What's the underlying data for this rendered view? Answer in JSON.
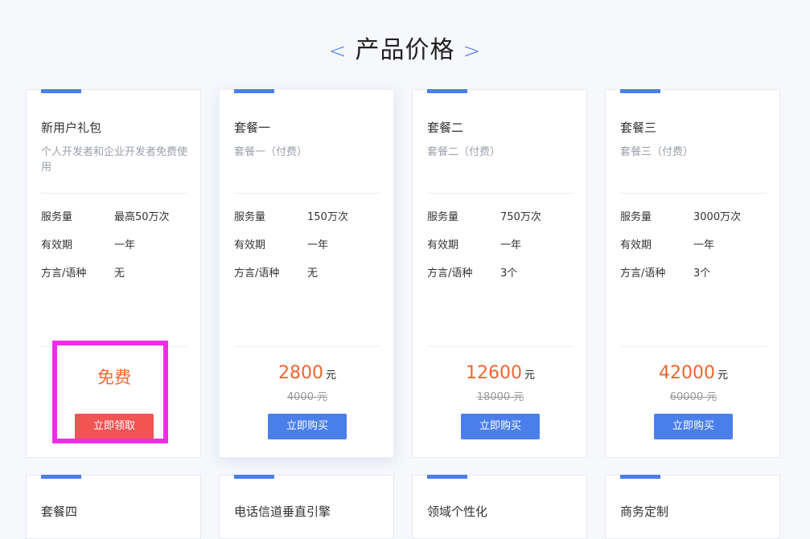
{
  "section": {
    "title": "产品价格",
    "left_arrow": "<",
    "right_arrow": ">"
  },
  "plans": [
    {
      "name": "新用户礼包",
      "desc": "个人开发者和企业开发者免费使用",
      "features": [
        {
          "k": "服务量",
          "v": "最高50万次"
        },
        {
          "k": "有效期",
          "v": "一年"
        },
        {
          "k": "方言/语种",
          "v": "无"
        }
      ],
      "price": "免费",
      "button": "立即领取"
    },
    {
      "name": "套餐一",
      "desc": "套餐一（付费）",
      "features": [
        {
          "k": "服务量",
          "v": "150万次"
        },
        {
          "k": "有效期",
          "v": "一年"
        },
        {
          "k": "方言/语种",
          "v": "无"
        }
      ],
      "price": "2800",
      "unit": "元",
      "old_price": "4000 元",
      "button": "立即购买"
    },
    {
      "name": "套餐二",
      "desc": "套餐二（付费）",
      "features": [
        {
          "k": "服务量",
          "v": "750万次"
        },
        {
          "k": "有效期",
          "v": "一年"
        },
        {
          "k": "方言/语种",
          "v": "3个"
        }
      ],
      "price": "12600",
      "unit": "元",
      "old_price": "18000 元",
      "button": "立即购买"
    },
    {
      "name": "套餐三",
      "desc": "套餐三（付费）",
      "features": [
        {
          "k": "服务量",
          "v": "3000万次"
        },
        {
          "k": "有效期",
          "v": "一年"
        },
        {
          "k": "方言/语种",
          "v": "3个"
        }
      ],
      "price": "42000",
      "unit": "元",
      "old_price": "60000 元",
      "button": "立即购买"
    }
  ],
  "second_row": [
    {
      "name": "套餐四"
    },
    {
      "name": "电话信道垂直引擎"
    },
    {
      "name": "领域个性化"
    },
    {
      "name": "商务定制"
    }
  ],
  "colors": {
    "accent": "#4a7eea",
    "price": "#f0652f",
    "free_button": "#f25353",
    "highlight": "#ee2ce8"
  }
}
